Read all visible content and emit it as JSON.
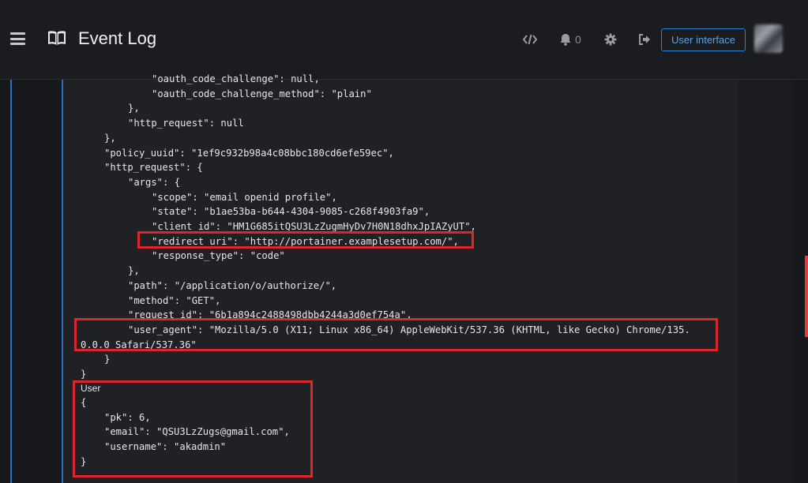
{
  "header": {
    "title": "Event Log",
    "notification_count": "0",
    "user_interface_label": "User interface"
  },
  "icons": {
    "menu": "hamburger-menu-icon",
    "logo": "book-icon",
    "api": "code-icon",
    "notifications": "bell-icon",
    "settings": "gear-icon",
    "logout": "sign-out-icon"
  },
  "code_lines": [
    {
      "indent": 3,
      "text": "\"oauth_code_challenge\": null,"
    },
    {
      "indent": 3,
      "text": "\"oauth_code_challenge_method\": \"plain\""
    },
    {
      "indent": 2,
      "text": "},"
    },
    {
      "indent": 2,
      "text": "\"http_request\": null"
    },
    {
      "indent": 1,
      "text": "},"
    },
    {
      "indent": 1,
      "text": "\"policy_uuid\": \"1ef9c932b98a4c08bbc180cd6efe59ec\","
    },
    {
      "indent": 1,
      "text": "\"http_request\": {"
    },
    {
      "indent": 2,
      "text": "\"args\": {"
    },
    {
      "indent": 3,
      "text": "\"scope\": \"email openid profile\","
    },
    {
      "indent": 3,
      "text": "\"state\": \"b1ae53ba-b644-4304-9085-c268f4903fa9\","
    },
    {
      "indent": 3,
      "text": "\"client_id\": \"HM1G685itQSU3LzZugmHyDv7H0N18dhxJpIAZyUT\","
    },
    {
      "indent": 3,
      "text": "\"redirect_uri\": \"http://portainer.examplesetup.com/\","
    },
    {
      "indent": 3,
      "text": "\"response_type\": \"code\""
    },
    {
      "indent": 2,
      "text": "},"
    },
    {
      "indent": 2,
      "text": "\"path\": \"/application/o/authorize/\","
    },
    {
      "indent": 2,
      "text": "\"method\": \"GET\","
    },
    {
      "indent": 2,
      "text": "\"request_id\": \"6b1a894c2488498dbb4244a3d0ef754a\","
    },
    {
      "indent": 2,
      "text": "\"user_agent\": \"Mozilla/5.0 (X11; Linux x86_64) AppleWebKit/537.36 (KHTML, like Gecko) Chrome/135."
    },
    {
      "indent": 0,
      "text": "0.0.0 Safari/537.36\""
    },
    {
      "indent": 1,
      "text": "}"
    },
    {
      "indent": 0,
      "text": "}"
    }
  ],
  "user_section": {
    "label": "User",
    "lines": [
      {
        "indent": 0,
        "text": "{"
      },
      {
        "indent": 1,
        "text": "\"pk\": 6,"
      },
      {
        "indent": 1,
        "text": "\"email\": \"QSU3LzZugs@gmail.com\","
      },
      {
        "indent": 1,
        "text": "\"username\": \"akadmin\""
      },
      {
        "indent": 0,
        "text": "}"
      }
    ]
  },
  "colors": {
    "accent_blue": "#2b6fc4",
    "highlight_red": "#d9272d"
  }
}
